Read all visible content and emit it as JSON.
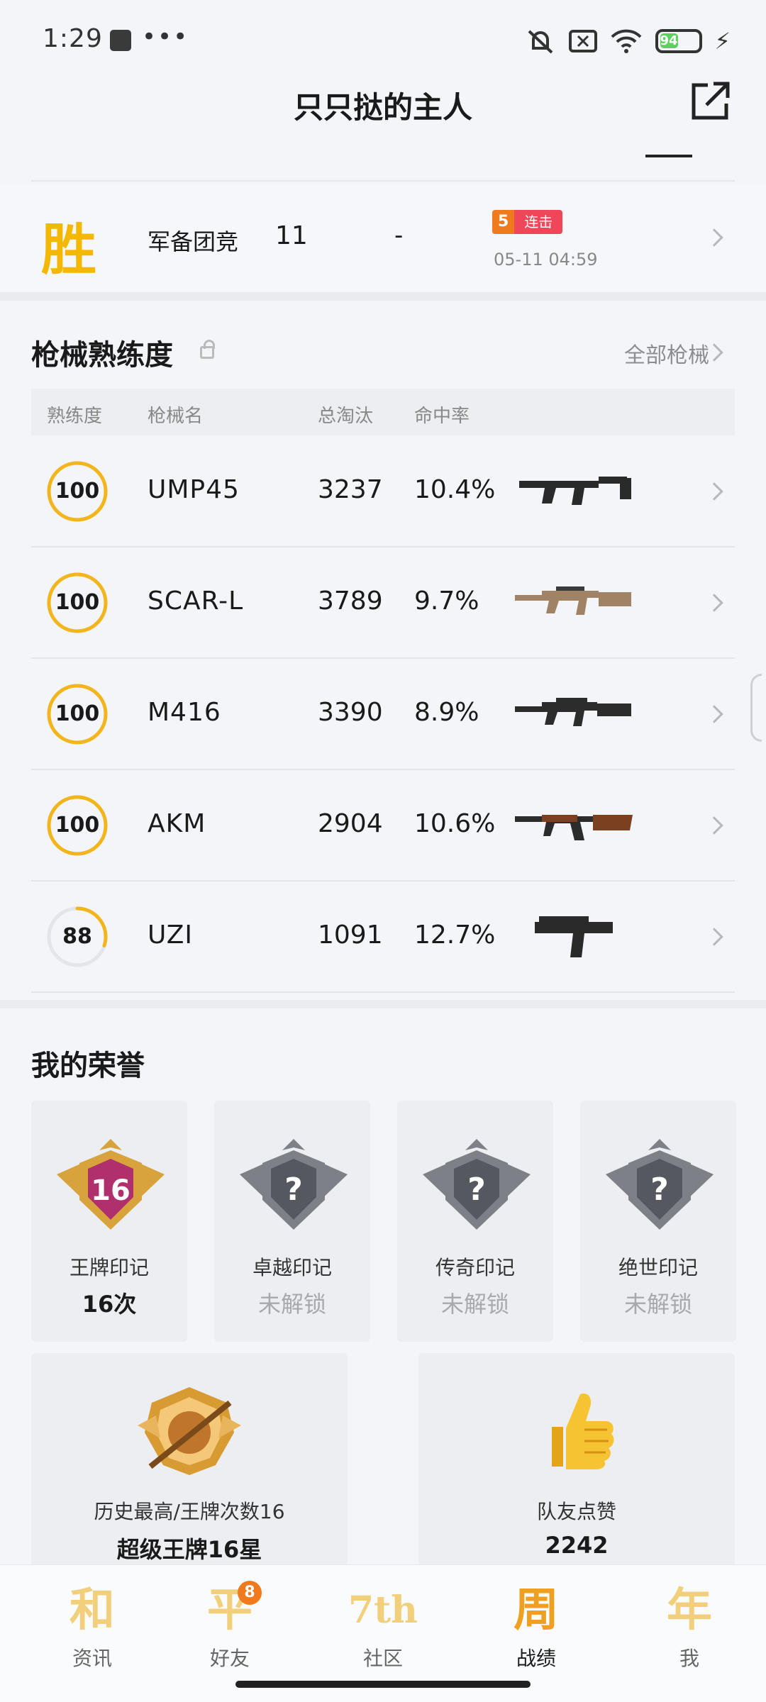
{
  "status_bar": {
    "time": "1:29",
    "dots": "•••",
    "battery": "94"
  },
  "header": {
    "title": "只只挞的主人"
  },
  "match": {
    "result": "胜",
    "mode": "军备团竞",
    "kills": "11",
    "dash": "-",
    "streak_count": "5",
    "streak_label": "连击",
    "datetime": "05-11 04:59"
  },
  "weapons": {
    "title": "枪械熟练度",
    "all_link": "全部枪械",
    "columns": [
      "熟练度",
      "枪械名",
      "总淘汰",
      "命中率"
    ],
    "rows": [
      {
        "proficiency": "100",
        "fill": 1.0,
        "name": "UMP45",
        "kills": "3237",
        "rate": "10.4%"
      },
      {
        "proficiency": "100",
        "fill": 1.0,
        "name": "SCAR-L",
        "kills": "3789",
        "rate": "9.7%"
      },
      {
        "proficiency": "100",
        "fill": 1.0,
        "name": "M416",
        "kills": "3390",
        "rate": "8.9%"
      },
      {
        "proficiency": "100",
        "fill": 1.0,
        "name": "AKM",
        "kills": "2904",
        "rate": "10.6%"
      },
      {
        "proficiency": "88",
        "fill": 0.3,
        "name": "UZI",
        "kills": "1091",
        "rate": "12.7%"
      }
    ]
  },
  "honor": {
    "title": "我的荣誉",
    "cards": [
      {
        "label": "王牌印记",
        "value": "16次",
        "badge_num": "16"
      },
      {
        "label": "卓越印记",
        "value": "未解锁",
        "badge_num": "?"
      },
      {
        "label": "传奇印记",
        "value": "未解锁",
        "badge_num": "?"
      },
      {
        "label": "绝世印记",
        "value": "未解锁",
        "badge_num": "?"
      }
    ],
    "best": {
      "label": "历史最高/王牌次数16",
      "value": "超级王牌16星"
    },
    "likes": {
      "label": "队友点赞",
      "value": "2242"
    }
  },
  "nav": {
    "items": [
      {
        "glyph": "和",
        "label": "资讯"
      },
      {
        "glyph": "平",
        "label": "好友",
        "badge": "8"
      },
      {
        "glyph": "7th",
        "label": "社区"
      },
      {
        "glyph": "周",
        "label": "战绩"
      },
      {
        "glyph": "年",
        "label": "我"
      }
    ]
  },
  "colors": {
    "accent": "#f5b800",
    "ring": "#f3b51c",
    "streak_orange": "#f07a1e",
    "streak_red": "#f0465a"
  }
}
